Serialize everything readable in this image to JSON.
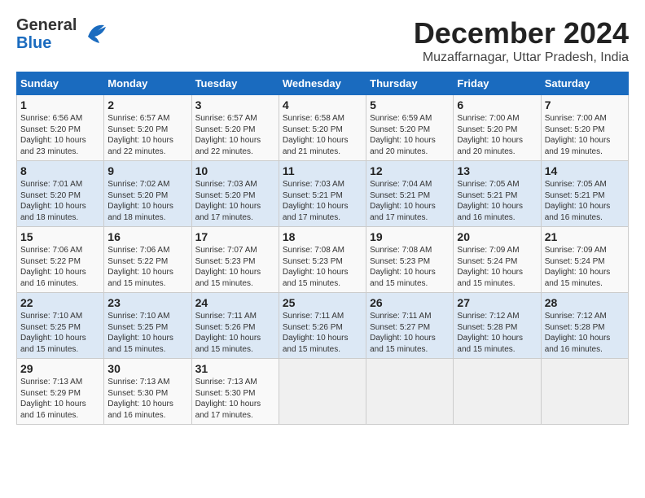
{
  "header": {
    "logo_general": "General",
    "logo_blue": "Blue",
    "month_title": "December 2024",
    "location": "Muzaffarnagar, Uttar Pradesh, India"
  },
  "calendar": {
    "days_of_week": [
      "Sunday",
      "Monday",
      "Tuesday",
      "Wednesday",
      "Thursday",
      "Friday",
      "Saturday"
    ],
    "weeks": [
      [
        {
          "day": "",
          "info": ""
        },
        {
          "day": "2",
          "info": "Sunrise: 6:57 AM\nSunset: 5:20 PM\nDaylight: 10 hours\nand 22 minutes."
        },
        {
          "day": "3",
          "info": "Sunrise: 6:57 AM\nSunset: 5:20 PM\nDaylight: 10 hours\nand 22 minutes."
        },
        {
          "day": "4",
          "info": "Sunrise: 6:58 AM\nSunset: 5:20 PM\nDaylight: 10 hours\nand 21 minutes."
        },
        {
          "day": "5",
          "info": "Sunrise: 6:59 AM\nSunset: 5:20 PM\nDaylight: 10 hours\nand 20 minutes."
        },
        {
          "day": "6",
          "info": "Sunrise: 7:00 AM\nSunset: 5:20 PM\nDaylight: 10 hours\nand 20 minutes."
        },
        {
          "day": "7",
          "info": "Sunrise: 7:00 AM\nSunset: 5:20 PM\nDaylight: 10 hours\nand 19 minutes."
        }
      ],
      [
        {
          "day": "1",
          "info": "Sunrise: 6:56 AM\nSunset: 5:20 PM\nDaylight: 10 hours\nand 23 minutes."
        },
        {
          "day": "",
          "info": ""
        },
        {
          "day": "",
          "info": ""
        },
        {
          "day": "",
          "info": ""
        },
        {
          "day": "",
          "info": ""
        },
        {
          "day": "",
          "info": ""
        },
        {
          "day": ""
        }
      ],
      [
        {
          "day": "8",
          "info": "Sunrise: 7:01 AM\nSunset: 5:20 PM\nDaylight: 10 hours\nand 18 minutes."
        },
        {
          "day": "9",
          "info": "Sunrise: 7:02 AM\nSunset: 5:20 PM\nDaylight: 10 hours\nand 18 minutes."
        },
        {
          "day": "10",
          "info": "Sunrise: 7:03 AM\nSunset: 5:20 PM\nDaylight: 10 hours\nand 17 minutes."
        },
        {
          "day": "11",
          "info": "Sunrise: 7:03 AM\nSunset: 5:21 PM\nDaylight: 10 hours\nand 17 minutes."
        },
        {
          "day": "12",
          "info": "Sunrise: 7:04 AM\nSunset: 5:21 PM\nDaylight: 10 hours\nand 17 minutes."
        },
        {
          "day": "13",
          "info": "Sunrise: 7:05 AM\nSunset: 5:21 PM\nDaylight: 10 hours\nand 16 minutes."
        },
        {
          "day": "14",
          "info": "Sunrise: 7:05 AM\nSunset: 5:21 PM\nDaylight: 10 hours\nand 16 minutes."
        }
      ],
      [
        {
          "day": "15",
          "info": "Sunrise: 7:06 AM\nSunset: 5:22 PM\nDaylight: 10 hours\nand 16 minutes."
        },
        {
          "day": "16",
          "info": "Sunrise: 7:06 AM\nSunset: 5:22 PM\nDaylight: 10 hours\nand 15 minutes."
        },
        {
          "day": "17",
          "info": "Sunrise: 7:07 AM\nSunset: 5:23 PM\nDaylight: 10 hours\nand 15 minutes."
        },
        {
          "day": "18",
          "info": "Sunrise: 7:08 AM\nSunset: 5:23 PM\nDaylight: 10 hours\nand 15 minutes."
        },
        {
          "day": "19",
          "info": "Sunrise: 7:08 AM\nSunset: 5:23 PM\nDaylight: 10 hours\nand 15 minutes."
        },
        {
          "day": "20",
          "info": "Sunrise: 7:09 AM\nSunset: 5:24 PM\nDaylight: 10 hours\nand 15 minutes."
        },
        {
          "day": "21",
          "info": "Sunrise: 7:09 AM\nSunset: 5:24 PM\nDaylight: 10 hours\nand 15 minutes."
        }
      ],
      [
        {
          "day": "22",
          "info": "Sunrise: 7:10 AM\nSunset: 5:25 PM\nDaylight: 10 hours\nand 15 minutes."
        },
        {
          "day": "23",
          "info": "Sunrise: 7:10 AM\nSunset: 5:25 PM\nDaylight: 10 hours\nand 15 minutes."
        },
        {
          "day": "24",
          "info": "Sunrise: 7:11 AM\nSunset: 5:26 PM\nDaylight: 10 hours\nand 15 minutes."
        },
        {
          "day": "25",
          "info": "Sunrise: 7:11 AM\nSunset: 5:26 PM\nDaylight: 10 hours\nand 15 minutes."
        },
        {
          "day": "26",
          "info": "Sunrise: 7:11 AM\nSunset: 5:27 PM\nDaylight: 10 hours\nand 15 minutes."
        },
        {
          "day": "27",
          "info": "Sunrise: 7:12 AM\nSunset: 5:28 PM\nDaylight: 10 hours\nand 15 minutes."
        },
        {
          "day": "28",
          "info": "Sunrise: 7:12 AM\nSunset: 5:28 PM\nDaylight: 10 hours\nand 16 minutes."
        }
      ],
      [
        {
          "day": "29",
          "info": "Sunrise: 7:13 AM\nSunset: 5:29 PM\nDaylight: 10 hours\nand 16 minutes."
        },
        {
          "day": "30",
          "info": "Sunrise: 7:13 AM\nSunset: 5:30 PM\nDaylight: 10 hours\nand 16 minutes."
        },
        {
          "day": "31",
          "info": "Sunrise: 7:13 AM\nSunset: 5:30 PM\nDaylight: 10 hours\nand 17 minutes."
        },
        {
          "day": "",
          "info": ""
        },
        {
          "day": "",
          "info": ""
        },
        {
          "day": "",
          "info": ""
        },
        {
          "day": "",
          "info": ""
        }
      ]
    ]
  }
}
